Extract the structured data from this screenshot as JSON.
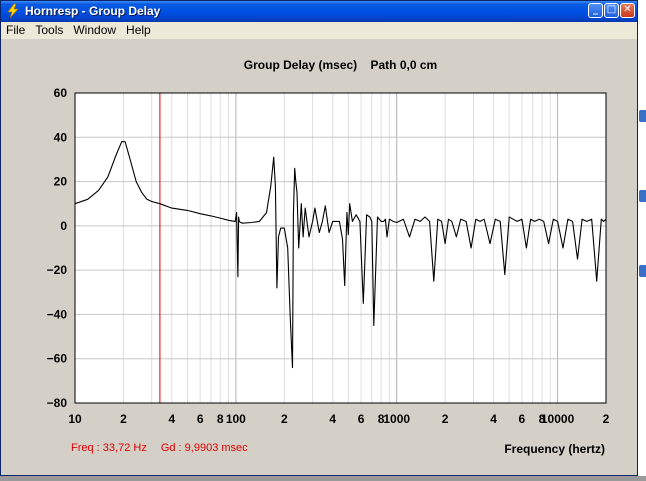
{
  "window": {
    "title": "Hornresp - Group Delay",
    "minimize_glyph": "_",
    "maximize_glyph": "□",
    "close_glyph": "✕"
  },
  "menu": [
    "File",
    "Tools",
    "Window",
    "Help"
  ],
  "readout": {
    "freq": "Freq : 33,72 Hz",
    "gd": "Gd : 9,9903 msec"
  },
  "colors": {
    "trace": "#000000",
    "cursor": "#e00000",
    "grid": "#c8c8c8",
    "plot_bg": "#ffffff",
    "title_bar": "#0054e3"
  },
  "icons": [
    "lightning-app-icon",
    "minimize-icon",
    "maximize-icon",
    "close-icon"
  ],
  "chart_data": {
    "type": "line",
    "title": "Group Delay (msec)    Path 0,0 cm",
    "xlabel": "Frequency (hertz)",
    "ylabel": "",
    "x_scale": "log",
    "xlim": [
      10,
      20000
    ],
    "ylim": [
      -80,
      60
    ],
    "y_ticks": [
      60,
      40,
      20,
      0,
      -20,
      -40,
      -60,
      -80
    ],
    "x_tick_labels": [
      {
        "v": 10,
        "t": "10"
      },
      {
        "v": 20,
        "t": "2"
      },
      {
        "v": 40,
        "t": "4"
      },
      {
        "v": 60,
        "t": "6"
      },
      {
        "v": 80,
        "t": "8"
      },
      {
        "v": 100,
        "t": "100"
      },
      {
        "v": 200,
        "t": "2"
      },
      {
        "v": 400,
        "t": "4"
      },
      {
        "v": 600,
        "t": "6"
      },
      {
        "v": 800,
        "t": "8"
      },
      {
        "v": 1000,
        "t": "1000"
      },
      {
        "v": 2000,
        "t": "2"
      },
      {
        "v": 4000,
        "t": "4"
      },
      {
        "v": 6000,
        "t": "6"
      },
      {
        "v": 8000,
        "t": "8"
      },
      {
        "v": 10000,
        "t": "10000"
      },
      {
        "v": 20000,
        "t": "2"
      }
    ],
    "grid": true,
    "cursor_x": 33.72,
    "series": [
      {
        "x": [
          10,
          12,
          14,
          16,
          18,
          19.5,
          20.5,
          22,
          24,
          26,
          28,
          30,
          33.72,
          40,
          50,
          60,
          70,
          80,
          90,
          99,
          101,
          103,
          104,
          105,
          107,
          110,
          125,
          140,
          155,
          165,
          172,
          176,
          180,
          184,
          190,
          200,
          210,
          218,
          225,
          228,
          232,
          236,
          240,
          246,
          255,
          262,
          270,
          285,
          300,
          310,
          330,
          345,
          360,
          380,
          400,
          440,
          460,
          475,
          490,
          500,
          510,
          530,
          560,
          590,
          620,
          650,
          680,
          700,
          720,
          760,
          800,
          830,
          850,
          870,
          900,
          950,
          1000,
          1100,
          1200,
          1300,
          1400,
          1500,
          1600,
          1700,
          1800,
          1900,
          2000,
          2100,
          2200,
          2350,
          2500,
          2700,
          2900,
          3100,
          3300,
          3500,
          3800,
          4100,
          4400,
          4700,
          5000,
          5300,
          5600,
          6000,
          6400,
          6800,
          7200,
          7700,
          8200,
          8800,
          9400,
          10000,
          10800,
          11600,
          12400,
          13300,
          14200,
          15200,
          16300,
          17500,
          18700,
          19300,
          20000
        ],
        "y": [
          10,
          12,
          16,
          22,
          32,
          38,
          38,
          30,
          20,
          15,
          12,
          11,
          9.99,
          8,
          7,
          5.5,
          4.5,
          3.5,
          2.5,
          2,
          6,
          -23,
          4,
          2,
          1.5,
          1.2,
          1.5,
          2,
          6,
          18,
          31,
          18,
          -28,
          -5,
          -1,
          -1,
          -10,
          -42,
          -64,
          5,
          26,
          20,
          15,
          -10,
          10,
          -5,
          8,
          -5,
          2,
          8,
          -3,
          2,
          9,
          -3,
          2,
          2,
          -6,
          -27,
          6,
          -4,
          10,
          2,
          5,
          2,
          -35,
          5,
          4,
          2,
          -45,
          4,
          2,
          2,
          3,
          -5,
          3,
          2,
          1.5,
          3,
          -5,
          3,
          2,
          4,
          2,
          -25,
          3,
          2,
          -8,
          3,
          2,
          -5,
          3,
          2,
          -10,
          3,
          2,
          3,
          -8,
          3,
          2,
          -22,
          4,
          3,
          2,
          3,
          -10,
          3,
          2,
          3,
          2,
          -8,
          3,
          2,
          -10,
          3,
          2,
          -15,
          3,
          2,
          3,
          -25,
          3,
          2,
          3
        ]
      }
    ]
  }
}
